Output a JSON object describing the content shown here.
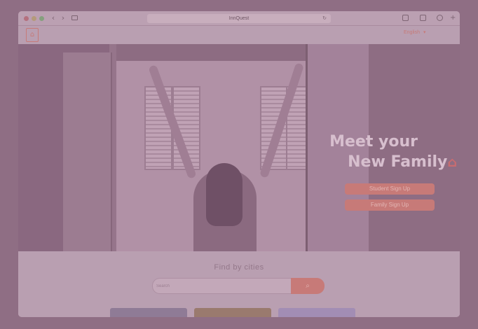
{
  "browser": {
    "url": "InnQuest",
    "icons": [
      "back-icon",
      "forward-icon",
      "sidebar-icon",
      "reload-icon",
      "share-icon",
      "tabs-icon",
      "settings-icon",
      "new-tab-icon"
    ]
  },
  "header": {
    "logo_icon": "logo-icon",
    "language": "English"
  },
  "hero": {
    "title_line1": "Meet your",
    "title_line2": "New Family",
    "title_icon": "house-icon",
    "student_signup": "Student Sign Up",
    "family_signup": "Family Sign Up"
  },
  "cities": {
    "title": "Find by cities",
    "search_placeholder": "Search",
    "search_icon": "search-icon"
  },
  "colors": {
    "accent": "#c77a78",
    "overlay": "#8f6e84"
  }
}
